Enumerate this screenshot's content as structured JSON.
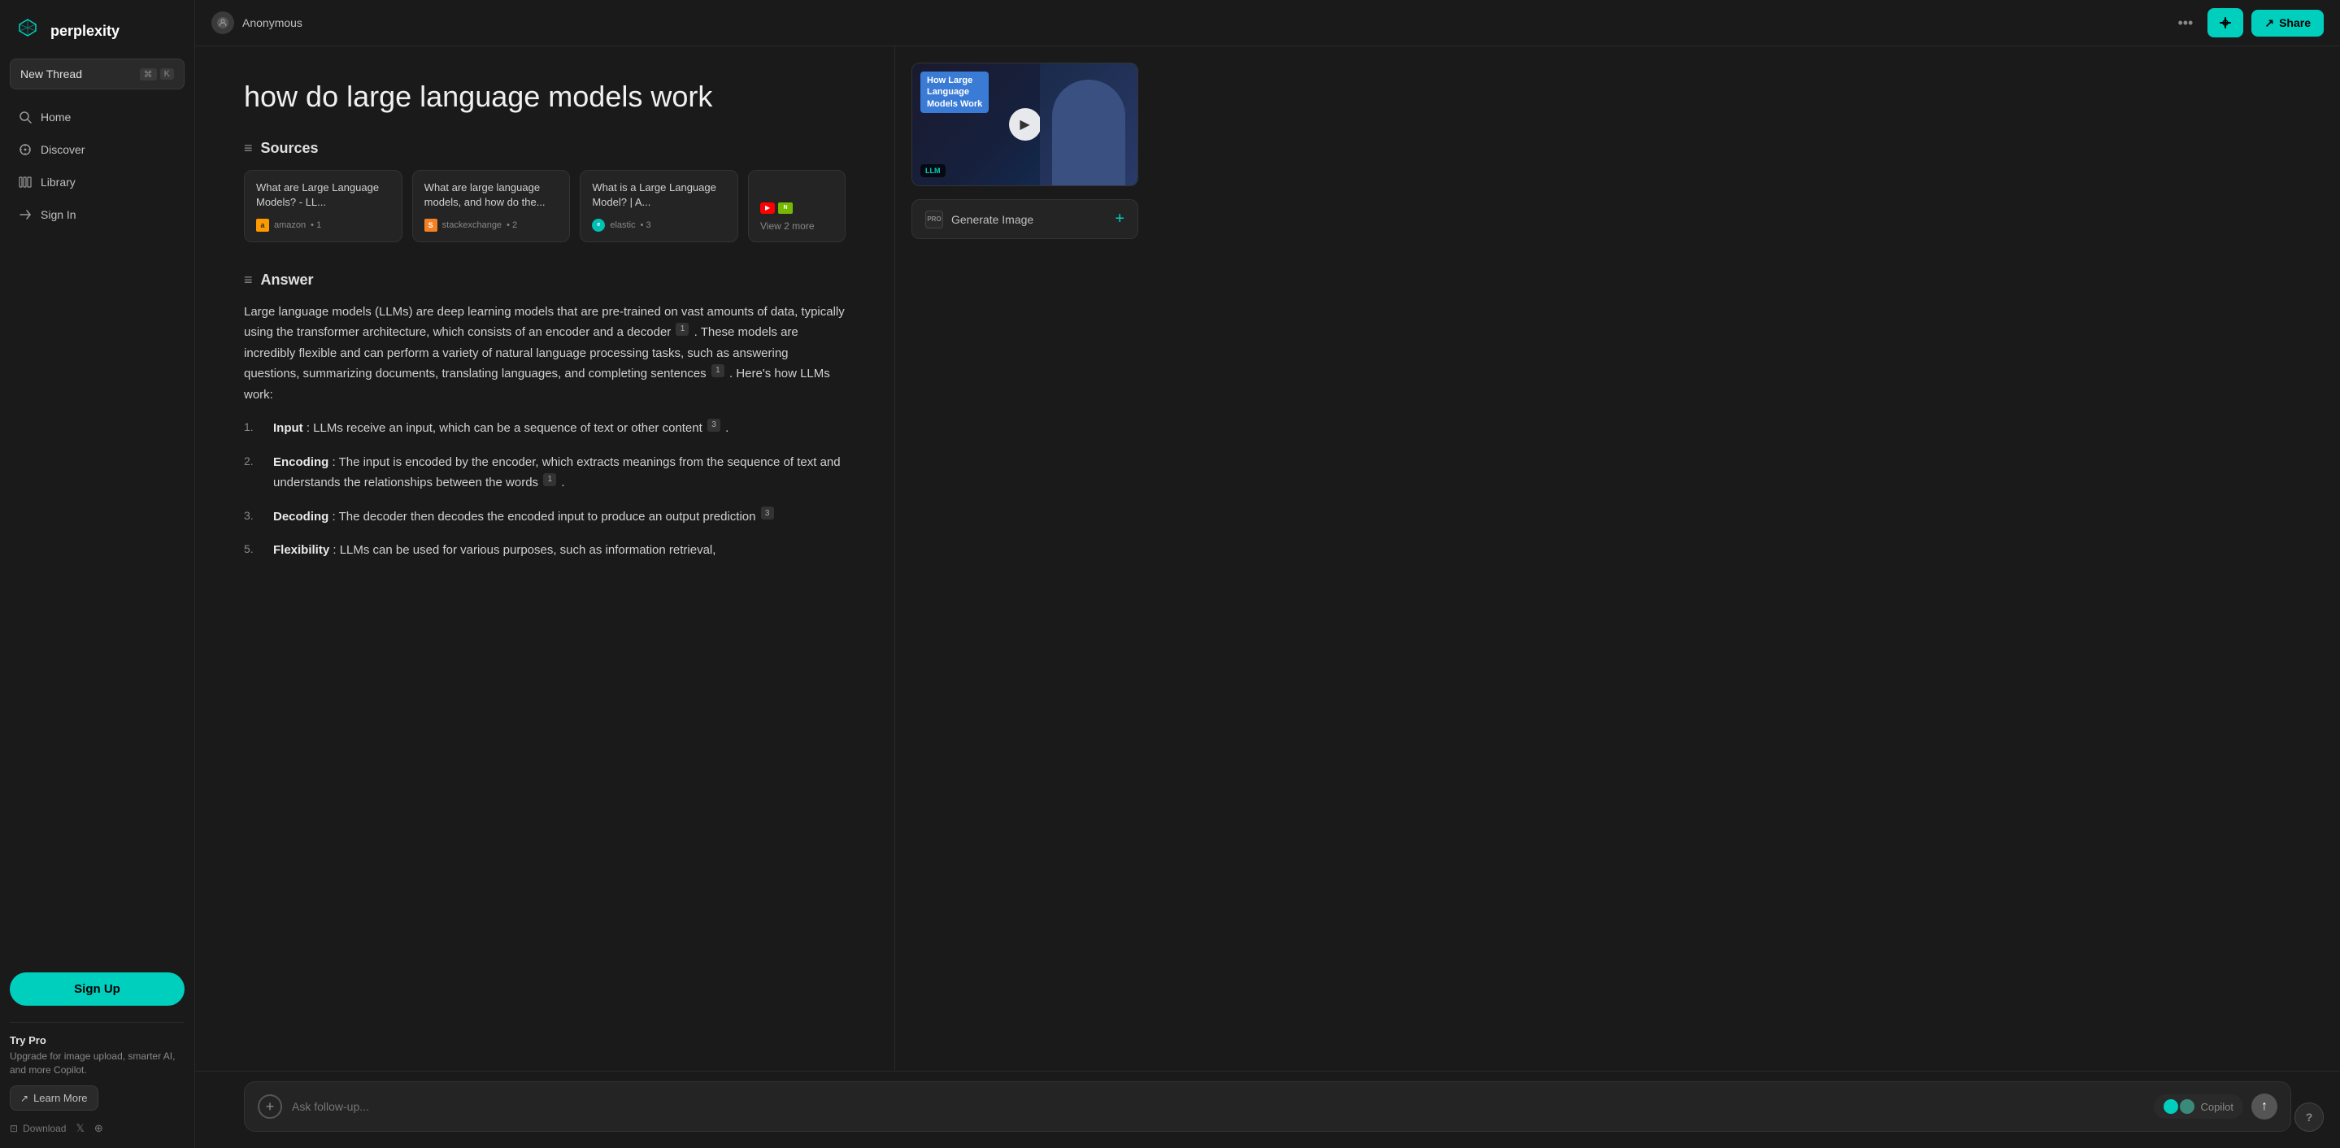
{
  "app": {
    "name": "perplexity"
  },
  "sidebar": {
    "new_thread_label": "New Thread",
    "shortcut_cmd": "⌘",
    "shortcut_key": "K",
    "nav_items": [
      {
        "id": "home",
        "label": "Home",
        "icon": "search"
      },
      {
        "id": "discover",
        "label": "Discover",
        "icon": "compass"
      },
      {
        "id": "library",
        "label": "Library",
        "icon": "library"
      },
      {
        "id": "signin",
        "label": "Sign In",
        "icon": "signin"
      }
    ],
    "sign_up_label": "Sign Up",
    "try_pro_heading": "Try Pro",
    "try_pro_desc": "Upgrade for image upload, smarter AI, and more Copilot.",
    "learn_more_label": "Learn More",
    "download_label": "Download"
  },
  "header": {
    "anon_label": "Anonymous",
    "more_icon": "···",
    "share_label": "Share",
    "focus_icon": "⊕"
  },
  "main": {
    "page_title": "how do large language models work",
    "sources_heading": "Sources",
    "answer_heading": "Answer",
    "sources": [
      {
        "title": "What are Large Language Models? - LL...",
        "site": "amazon",
        "site_name": "amazon",
        "num": "1"
      },
      {
        "title": "What are large language models, and how do the...",
        "site": "stackexchange",
        "site_name": "stackexchange",
        "num": "2"
      },
      {
        "title": "What is a Large Language Model? | A...",
        "site": "elastic",
        "site_name": "elastic",
        "num": "3"
      },
      {
        "title": "View 2 more",
        "site": "youtube+nvidia",
        "site_name": "",
        "num": ""
      }
    ],
    "answer_intro": "Large language models (LLMs) are deep learning models that are pre-trained on vast amounts of data, typically using the transformer architecture, which consists of an encoder and a decoder",
    "answer_cite1": "1",
    "answer_intro2": ". These models are incredibly flexible and can perform a variety of natural language processing tasks, such as answering questions, summarizing documents, translating languages, and completing sentences",
    "answer_cite2": "1",
    "answer_intro3": ". Here's how LLMs work:",
    "list_items": [
      {
        "num": "1.",
        "term": "Input",
        "text": ": LLMs receive an input, which can be a sequence of text or other content",
        "cite": "3"
      },
      {
        "num": "2.",
        "term": "Encoding",
        "text": ": The input is encoded by the encoder, which extracts meanings from the sequence of text and understands the relationships between the words",
        "cite": "1"
      },
      {
        "num": "3.",
        "term": "Decoding",
        "text": ": The decoder then decodes the encoded input to produce an output prediction",
        "cite": "3"
      },
      {
        "num": "5.",
        "term": "Flexibility",
        "text": ": LLMs can be used for various purposes, such as information retrieval,",
        "cite": ""
      }
    ],
    "follow_up_placeholder": "Ask follow-up...",
    "copilot_label": "Copilot"
  },
  "right_panel": {
    "video_title": "How Large Language Models Work",
    "video_badge_line1": "How Large",
    "video_badge_line2": "Language",
    "video_badge_line3": "Models Work",
    "generate_image_label": "Generate Image",
    "pro_badge": "PRO"
  }
}
